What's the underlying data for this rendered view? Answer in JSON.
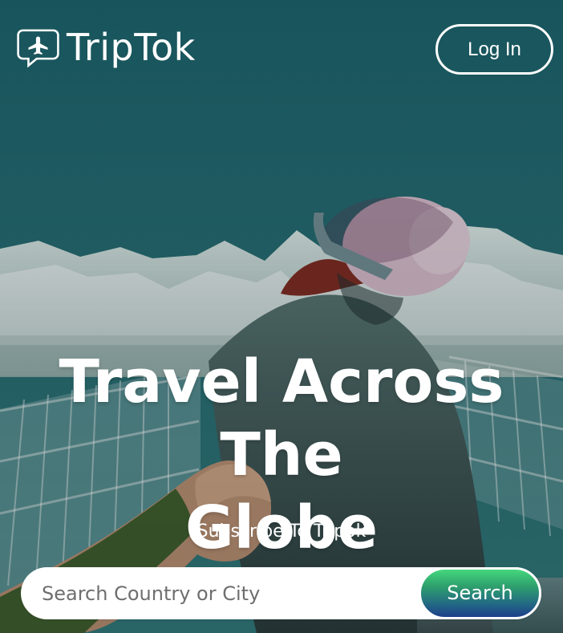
{
  "header": {
    "brand": "TripTok",
    "login_label": "Log In"
  },
  "hero": {
    "headline_line_1": "Travel Across The",
    "headline_line_2": "Globe",
    "subtitle": "Subscribe To Tripok"
  },
  "search": {
    "placeholder": "Search Country or City",
    "button_label": "Search"
  },
  "icons": {
    "logo": "airplane-chat-icon"
  },
  "colors": {
    "white": "#ffffff",
    "search_gradient_top": "#44d77d",
    "search_gradient_bottom": "#1d3e8a"
  }
}
